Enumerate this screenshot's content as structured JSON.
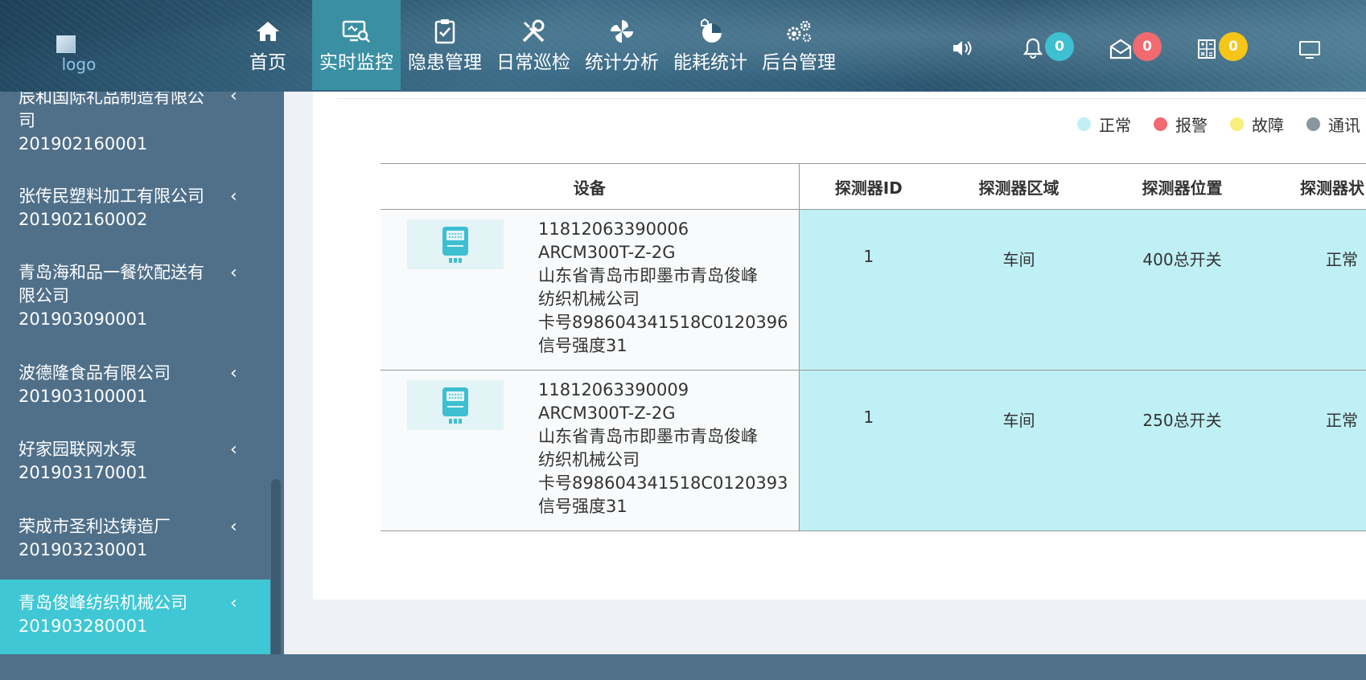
{
  "header": {
    "logo_alt": "logo",
    "nav": [
      {
        "label": "首页",
        "icon": "home-icon"
      },
      {
        "label": "实时监控",
        "icon": "monitor-search-icon",
        "active": true
      },
      {
        "label": "隐患管理",
        "icon": "clipboard-check-icon"
      },
      {
        "label": "日常巡检",
        "icon": "tools-icon"
      },
      {
        "label": "统计分析",
        "icon": "pinwheel-icon"
      },
      {
        "label": "能耗统计",
        "icon": "pie-chart-icon"
      },
      {
        "label": "后台管理",
        "icon": "gears-icon"
      }
    ],
    "badges": {
      "bell": "0",
      "mail": "0",
      "calc": "0"
    },
    "badge_colors": {
      "bell": "#3ec0d2",
      "mail": "#f06a6f",
      "calc": "#f5c518"
    }
  },
  "sidebar": {
    "items": [
      {
        "name": "辰和国际礼品制造有限公司",
        "code": "201902160001"
      },
      {
        "name": "张传民塑料加工有限公司",
        "code": "201902160002"
      },
      {
        "name": "青岛海和品一餐饮配送有限公司",
        "code": "201903090001"
      },
      {
        "name": "波德隆食品有限公司",
        "code": "201903100001"
      },
      {
        "name": "好家园联网水泵",
        "code": "201903170001"
      },
      {
        "name": "荣成市圣利达铸造厂",
        "code": "201903230001"
      },
      {
        "name": "青岛俊峰纺织机械公司",
        "code": "201903280001",
        "active": true
      }
    ]
  },
  "legend": [
    {
      "label": "正常",
      "color": "#bff0f5"
    },
    {
      "label": "报警",
      "color": "#f06a6f"
    },
    {
      "label": "故障",
      "color": "#f7ef7a"
    },
    {
      "label": "通讯",
      "color": "#8a979f"
    }
  ],
  "table": {
    "headers": [
      "设备",
      "探测器ID",
      "探测器区域",
      "探测器位置",
      "探测器状"
    ],
    "rows": [
      {
        "device_id": "11812063390006",
        "model": "ARCM300T-Z-2G",
        "address1": "山东省青岛市即墨市青岛俊峰",
        "address2": "纺织机械公司",
        "card": "卡号898604341518C0120396",
        "signal": "信号强度31",
        "detector_id": "1",
        "area": "车间",
        "position": "400总开关",
        "status": "正常"
      },
      {
        "device_id": "11812063390009",
        "model": "ARCM300T-Z-2G",
        "address1": "山东省青岛市即墨市青岛俊峰",
        "address2": "纺织机械公司",
        "card": "卡号898604341518C0120393",
        "signal": "信号强度31",
        "detector_id": "1",
        "area": "车间",
        "position": "250总开关",
        "status": "正常"
      }
    ]
  }
}
